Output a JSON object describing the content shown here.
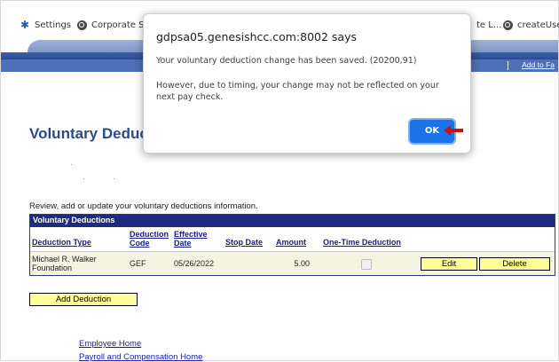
{
  "bookmarks": [
    {
      "label": "Settings",
      "icon": "gear-icon"
    },
    {
      "label": "Corporate S",
      "icon": "globe-icon"
    },
    {
      "label": "te L...",
      "icon": "none"
    },
    {
      "label": "createUse",
      "icon": "globe-icon"
    }
  ],
  "header": {
    "add_link": "Add to Fa"
  },
  "page": {
    "title": "Voluntary Deducti",
    "intro": "Review, add or update your voluntary deductions information."
  },
  "grid": {
    "title": "Voluntary Deductions",
    "columns": [
      "Deduction Type",
      "Deduction Code",
      "Effective Date",
      "Stop Date",
      "Amount",
      "One-Time Deduction"
    ],
    "rows": [
      {
        "type": "Michael R. Walker Foundation",
        "code": "GEF",
        "effective": "05/26/2022",
        "stop": "",
        "amount": "5.00",
        "one_time": false
      }
    ],
    "edit_label": "Edit",
    "delete_label": "Delete"
  },
  "add_deduction_label": "Add Deduction",
  "links": [
    "Employee Home",
    "Payroll and Compensation Home"
  ],
  "dialog": {
    "title": "gdpsa05.genesishcc.com:8002 says",
    "message1": "Your voluntary deduction change has been saved. (20200,91)",
    "message2": "However, due to timing, your change may not be reflected on your next pay check.",
    "ok_label": "OK"
  },
  "colors": {
    "accent": "#1a73e8",
    "header_blue": "#202a7c",
    "title_blue": "#2c4a8a",
    "button_yellow": "#ffff99",
    "arrow_red": "#cc1111"
  }
}
